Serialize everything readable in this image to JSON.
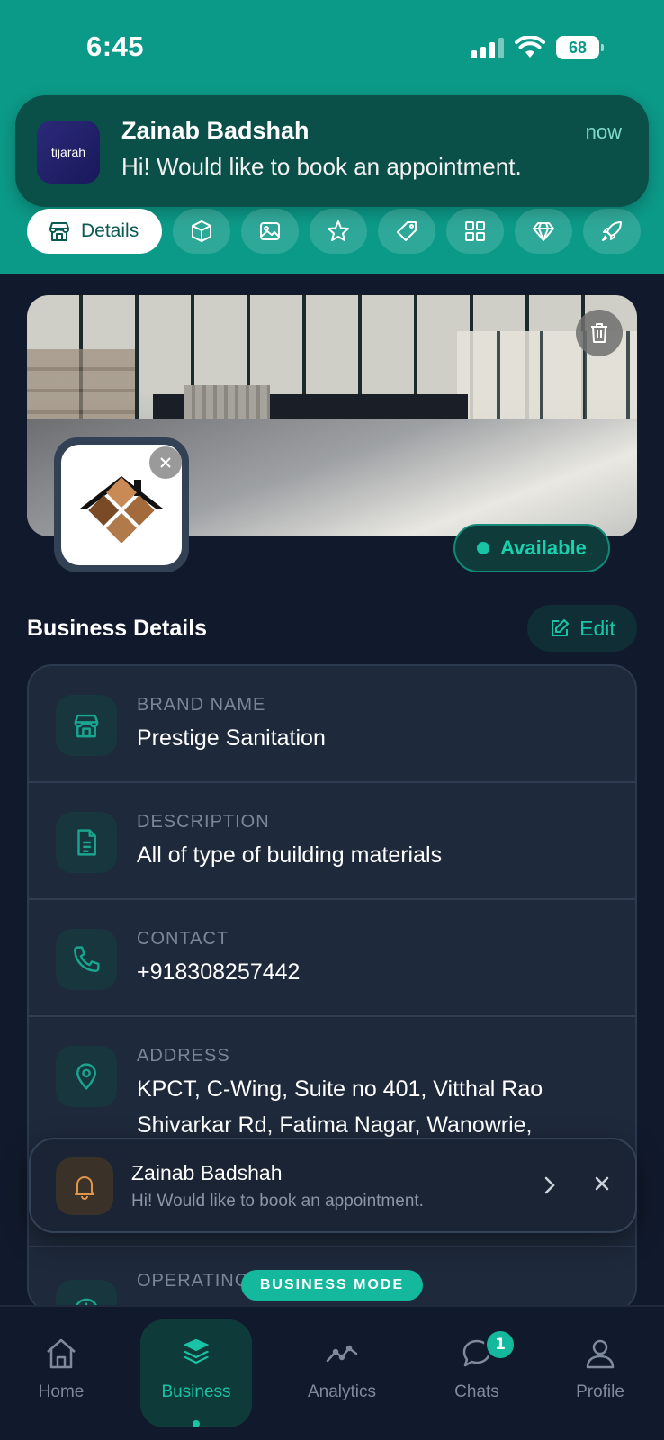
{
  "status_bar": {
    "time": "6:45",
    "battery": "68"
  },
  "system_notification": {
    "app_name": "tijarah",
    "title": "Zainab Badshah",
    "time": "now",
    "message": "Hi! Would like to book an appointment."
  },
  "tabs": [
    {
      "label": "Details",
      "icon": "store-icon",
      "active": true
    },
    {
      "icon": "box-icon"
    },
    {
      "icon": "image-icon"
    },
    {
      "icon": "star-icon"
    },
    {
      "icon": "tag-icon"
    },
    {
      "icon": "grid-icon"
    },
    {
      "icon": "diamond-icon"
    },
    {
      "icon": "rocket-icon"
    }
  ],
  "business": {
    "availability": "Available",
    "section_title": "Business Details",
    "edit_label": "Edit",
    "fields": [
      {
        "label": "BRAND NAME",
        "value": "Prestige Sanitation",
        "icon": "store-icon"
      },
      {
        "label": "DESCRIPTION",
        "value": "All of type of building materials",
        "icon": "document-icon"
      },
      {
        "label": "CONTACT",
        "value": "+918308257442",
        "icon": "phone-icon"
      },
      {
        "label": "ADDRESS",
        "value": "KPCT, C-Wing, Suite no 401, Vitthal Rao Shivarkar Rd, Fatima Nagar, Wanowrie,",
        "icon": "location-icon"
      },
      {
        "label": "OPERATING",
        "value": "",
        "icon": "clock-icon"
      }
    ]
  },
  "in_app_notification": {
    "title": "Zainab Badshah",
    "message": "Hi! Would like to book an appointment."
  },
  "mode_badge": "BUSINESS MODE",
  "bottom_nav": {
    "items": [
      {
        "label": "Home",
        "icon": "home-icon"
      },
      {
        "label": "Business",
        "icon": "layers-icon",
        "active": true
      },
      {
        "label": "Analytics",
        "icon": "analytics-icon"
      },
      {
        "label": "Chats",
        "icon": "chat-icon",
        "badge": "1"
      },
      {
        "label": "Profile",
        "icon": "profile-icon"
      }
    ]
  },
  "colors": {
    "header_teal": "#0c9a88",
    "accent": "#19c4a6",
    "background": "#111a2c",
    "card": "#1e293b"
  }
}
